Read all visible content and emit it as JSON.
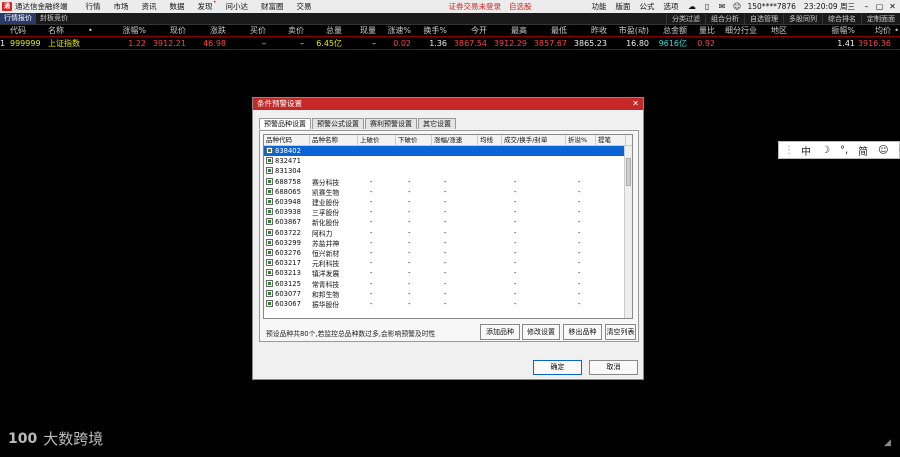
{
  "menubar": {
    "logo_text": "通",
    "app_title": "通达信金融终端",
    "items": [
      "行情",
      "市场",
      "资讯",
      "数据",
      "发现",
      "问小达",
      "财富圈",
      "交易"
    ],
    "notify_dot": "•",
    "login_link": "证券交易未登录",
    "watchlist_link": "自选股",
    "right_items": [
      "功能",
      "版面",
      "公式",
      "选项"
    ],
    "user": "150****7876",
    "clock": "23:20:09 周三",
    "win_min": "–",
    "win_max": "▢",
    "win_close": "✕"
  },
  "tabs": {
    "left": [
      "行情报价",
      "封板竞价"
    ],
    "right": [
      "分类过滤",
      "组合分析",
      "自选管理",
      "多股同列",
      "综合排名",
      "定制面面"
    ]
  },
  "quote_header": [
    "",
    "代码",
    "名称",
    "•",
    "涨幅%",
    "现价",
    "涨跌",
    "买价",
    "卖价",
    "总量",
    "现量",
    "涨速%",
    "换手%",
    "今开",
    "最高",
    "最低",
    "昨收",
    "市盈(动)",
    "总金额",
    "量比",
    "细分行业",
    "地区",
    "振幅%",
    "均价",
    "•"
  ],
  "quote_row": [
    "1",
    "999999",
    "上证指数",
    "",
    "1.22",
    "3912.21",
    "46.98",
    "–",
    "–",
    "6.45亿",
    "–",
    "0.02",
    "1.36",
    "3867.54",
    "3912.29",
    "3857.67",
    "3865.23",
    "16.80",
    "9616亿",
    "0.92",
    "",
    "",
    "1.41",
    "3916.36",
    ""
  ],
  "ime": {
    "items": [
      "中",
      "☽",
      "°,",
      "简",
      "☺",
      "⚙"
    ]
  },
  "watermark": {
    "logo": "100",
    "text": "大数跨境"
  },
  "corner_icon": "◢",
  "dialog": {
    "title": "条件预警设置",
    "close": "✕",
    "tabs": [
      "预警品种设置",
      "预警公式设置",
      "赛利预警设置",
      "其它设置"
    ],
    "columns": [
      "品种代码",
      "品种名称",
      "上破价",
      "下破价",
      "涨幅/涨速",
      "均线",
      "成交/换手/封单",
      "折溢%",
      "提笔"
    ],
    "rows": [
      {
        "code": "838402",
        "name": "",
        "up": "",
        "down": "",
        "chg": "",
        "ma": "",
        "vol": "",
        "prem": ""
      },
      {
        "code": "832471",
        "name": "",
        "up": "",
        "down": "",
        "chg": "",
        "ma": "",
        "vol": "",
        "prem": ""
      },
      {
        "code": "831304",
        "name": "",
        "up": "",
        "down": "",
        "chg": "",
        "ma": "",
        "vol": "",
        "prem": ""
      },
      {
        "code": "688758",
        "name": "赛分科技",
        "up": "-",
        "down": "-",
        "chg": "-",
        "ma": "",
        "vol": "-",
        "prem": "-"
      },
      {
        "code": "688065",
        "name": "凯赛生物",
        "up": "-",
        "down": "-",
        "chg": "-",
        "ma": "",
        "vol": "-",
        "prem": "-"
      },
      {
        "code": "603948",
        "name": "建业股份",
        "up": "-",
        "down": "-",
        "chg": "-",
        "ma": "",
        "vol": "-",
        "prem": "-"
      },
      {
        "code": "603938",
        "name": "三孚股份",
        "up": "-",
        "down": "-",
        "chg": "-",
        "ma": "",
        "vol": "-",
        "prem": "-"
      },
      {
        "code": "603867",
        "name": "新化股份",
        "up": "-",
        "down": "-",
        "chg": "-",
        "ma": "",
        "vol": "-",
        "prem": "-"
      },
      {
        "code": "603722",
        "name": "阿科力",
        "up": "-",
        "down": "-",
        "chg": "-",
        "ma": "",
        "vol": "-",
        "prem": "-"
      },
      {
        "code": "603299",
        "name": "苏盐井神",
        "up": "-",
        "down": "-",
        "chg": "-",
        "ma": "",
        "vol": "-",
        "prem": "-"
      },
      {
        "code": "603276",
        "name": "恒兴新材",
        "up": "-",
        "down": "-",
        "chg": "-",
        "ma": "",
        "vol": "-",
        "prem": "-"
      },
      {
        "code": "603217",
        "name": "元利科技",
        "up": "-",
        "down": "-",
        "chg": "-",
        "ma": "",
        "vol": "-",
        "prem": "-"
      },
      {
        "code": "603213",
        "name": "镇洋发展",
        "up": "-",
        "down": "-",
        "chg": "-",
        "ma": "",
        "vol": "-",
        "prem": "-"
      },
      {
        "code": "603125",
        "name": "常青科技",
        "up": "-",
        "down": "-",
        "chg": "-",
        "ma": "",
        "vol": "-",
        "prem": "-"
      },
      {
        "code": "603077",
        "name": "和邦生物",
        "up": "-",
        "down": "-",
        "chg": "-",
        "ma": "",
        "vol": "-",
        "prem": "-"
      },
      {
        "code": "603067",
        "name": "振华股份",
        "up": "-",
        "down": "-",
        "chg": "-",
        "ma": "",
        "vol": "-",
        "prem": "-"
      }
    ],
    "hint": "预设品种共80个,若监控总品种数过多,会影响预警及时性",
    "panel_buttons": [
      "添加品种",
      "修改设置",
      "移出品种",
      "清空列表"
    ],
    "ok": "确定",
    "cancel": "取消"
  }
}
